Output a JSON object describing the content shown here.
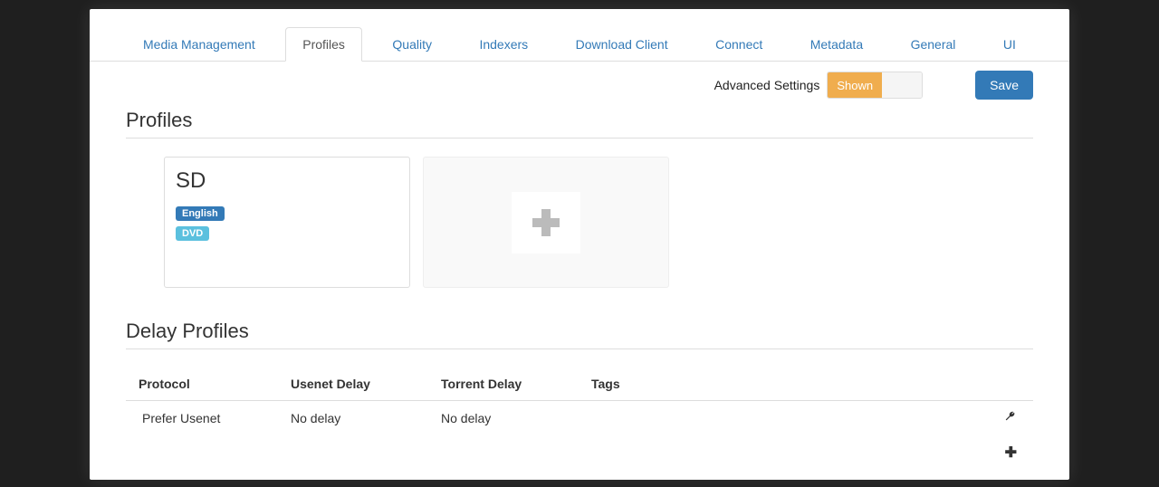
{
  "tabs": [
    {
      "label": "Media Management",
      "active": false
    },
    {
      "label": "Profiles",
      "active": true
    },
    {
      "label": "Quality",
      "active": false
    },
    {
      "label": "Indexers",
      "active": false
    },
    {
      "label": "Download Client",
      "active": false
    },
    {
      "label": "Connect",
      "active": false
    },
    {
      "label": "Metadata",
      "active": false
    },
    {
      "label": "General",
      "active": false
    },
    {
      "label": "UI",
      "active": false
    }
  ],
  "toolbar": {
    "advanced_label": "Advanced Settings",
    "toggle_state": "Shown",
    "save_label": "Save"
  },
  "profiles": {
    "title": "Profiles",
    "cards": [
      {
        "title": "SD",
        "badges": [
          {
            "label": "English",
            "type": "primary"
          },
          {
            "label": "DVD",
            "type": "info"
          }
        ]
      }
    ]
  },
  "delay_profiles": {
    "title": "Delay Profiles",
    "columns": {
      "protocol": "Protocol",
      "usenet_delay": "Usenet Delay",
      "torrent_delay": "Torrent Delay",
      "tags": "Tags"
    },
    "rows": [
      {
        "protocol": "Prefer Usenet",
        "usenet_delay": "No delay",
        "torrent_delay": "No delay",
        "tags": ""
      }
    ]
  }
}
